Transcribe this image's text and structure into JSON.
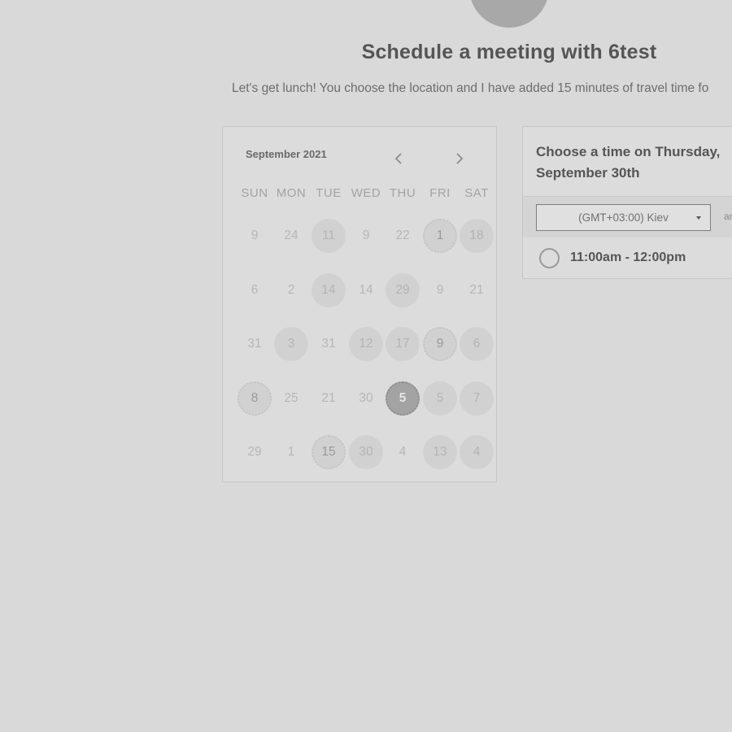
{
  "header": {
    "title": "Schedule a meeting with 6test",
    "subtitle": "Let's get lunch! You choose the location and I have added 15 minutes of travel time fo"
  },
  "calendar": {
    "month_label": "September 2021",
    "prev_icon": "chevron-left-icon",
    "next_icon": "chevron-right-icon",
    "weekdays": [
      "SUN",
      "MON",
      "TUE",
      "WED",
      "THU",
      "FRI",
      "SAT"
    ],
    "weeks": [
      [
        {
          "d": "9",
          "s": "muted"
        },
        {
          "d": "24",
          "s": "muted"
        },
        {
          "d": "11",
          "s": "avail"
        },
        {
          "d": "9",
          "s": "muted"
        },
        {
          "d": "22",
          "s": "muted"
        },
        {
          "d": "1",
          "s": "dotted"
        },
        {
          "d": "18",
          "s": "avail"
        }
      ],
      [
        {
          "d": "6",
          "s": "muted"
        },
        {
          "d": "2",
          "s": "muted"
        },
        {
          "d": "14",
          "s": "avail"
        },
        {
          "d": "14",
          "s": "muted"
        },
        {
          "d": "29",
          "s": "avail"
        },
        {
          "d": "9",
          "s": "muted"
        },
        {
          "d": "21",
          "s": "muted"
        }
      ],
      [
        {
          "d": "31",
          "s": "muted"
        },
        {
          "d": "3",
          "s": "avail"
        },
        {
          "d": "31",
          "s": "muted"
        },
        {
          "d": "12",
          "s": "avail"
        },
        {
          "d": "17",
          "s": "avail"
        },
        {
          "d": "9",
          "s": "dotted"
        },
        {
          "d": "6",
          "s": "avail"
        }
      ],
      [
        {
          "d": "8",
          "s": "dotted"
        },
        {
          "d": "25",
          "s": "muted"
        },
        {
          "d": "21",
          "s": "muted"
        },
        {
          "d": "30",
          "s": "muted"
        },
        {
          "d": "5",
          "s": "selected"
        },
        {
          "d": "5",
          "s": "avail"
        },
        {
          "d": "7",
          "s": "avail"
        }
      ],
      [
        {
          "d": "29",
          "s": "muted"
        },
        {
          "d": "1",
          "s": "muted"
        },
        {
          "d": "15",
          "s": "dotted"
        },
        {
          "d": "30",
          "s": "avail"
        },
        {
          "d": "4",
          "s": "muted"
        },
        {
          "d": "13",
          "s": "avail"
        },
        {
          "d": "4",
          "s": "avail"
        }
      ]
    ]
  },
  "time_panel": {
    "heading": "Choose a time on Thursday, September 30th",
    "timezone": "(GMT+03:00) Kiev",
    "timezone_extra": "an",
    "slots": [
      {
        "label": "11:00am - 12:00pm"
      }
    ]
  },
  "colors": {
    "background": "#d9d9d9",
    "panel": "#dcdcdc",
    "selected_day": "#a3a3a3",
    "available_day": "#d1d1d1"
  }
}
